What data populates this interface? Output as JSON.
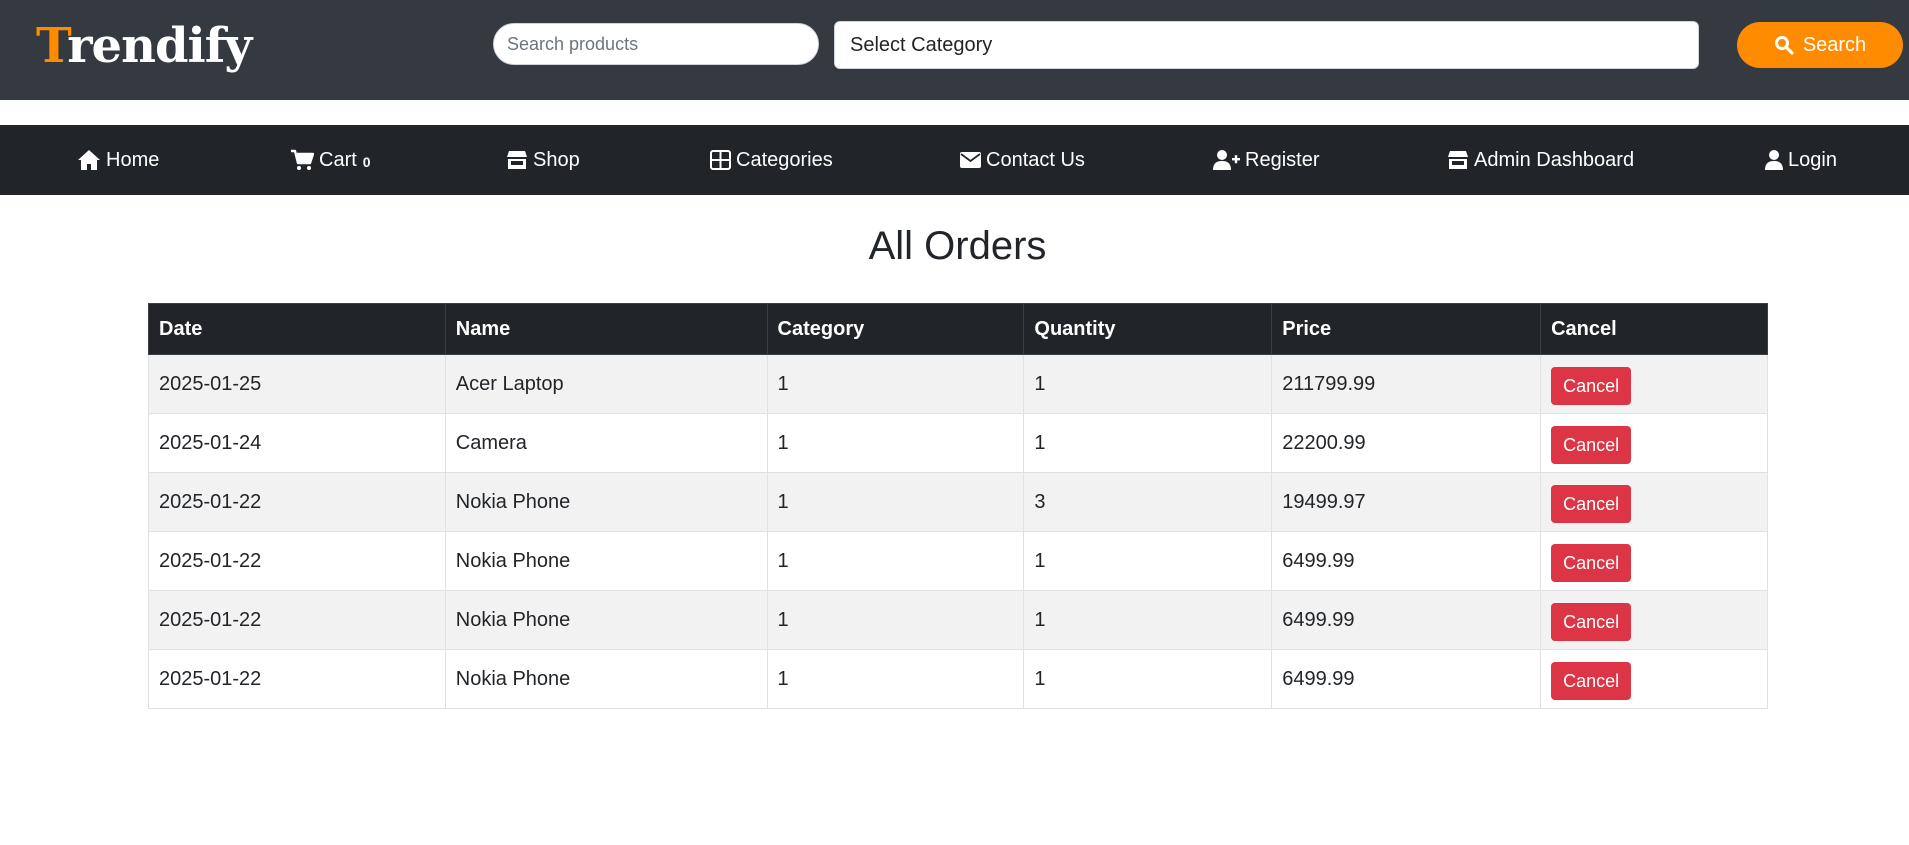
{
  "header": {
    "logo_first": "T",
    "logo_rest": "rendify",
    "search_placeholder": "Search products",
    "category_select": "Select Category",
    "search_button": "Search"
  },
  "nav": {
    "home": "Home",
    "cart": "Cart",
    "cart_count": "0",
    "shop": "Shop",
    "categories": "Categories",
    "contact": "Contact Us",
    "register": "Register",
    "admin": "Admin Dashboard",
    "login": "Login"
  },
  "page": {
    "title": "All Orders"
  },
  "orders": {
    "headers": [
      "Date",
      "Name",
      "Category",
      "Quantity",
      "Price",
      "Cancel"
    ],
    "rows": [
      {
        "date": "2025-01-25",
        "name": "Acer Laptop",
        "category": "1",
        "quantity": "1",
        "price": "211799.99",
        "action": "Cancel"
      },
      {
        "date": "2025-01-24",
        "name": "Camera",
        "category": "1",
        "quantity": "1",
        "price": "22200.99",
        "action": "Cancel"
      },
      {
        "date": "2025-01-22",
        "name": "Nokia Phone",
        "category": "1",
        "quantity": "3",
        "price": "19499.97",
        "action": "Cancel"
      },
      {
        "date": "2025-01-22",
        "name": "Nokia Phone",
        "category": "1",
        "quantity": "1",
        "price": "6499.99",
        "action": "Cancel"
      },
      {
        "date": "2025-01-22",
        "name": "Nokia Phone",
        "category": "1",
        "quantity": "1",
        "price": "6499.99",
        "action": "Cancel"
      },
      {
        "date": "2025-01-22",
        "name": "Nokia Phone",
        "category": "1",
        "quantity": "1",
        "price": "6499.99",
        "action": "Cancel"
      }
    ]
  },
  "colors": {
    "header_bg": "#343a40",
    "nav_bg": "#212529",
    "accent": "#ff8c00",
    "danger": "#dc3545"
  },
  "icons": [
    "search-icon",
    "home-icon",
    "cart-icon",
    "shop-icon",
    "categories-icon",
    "envelope-icon",
    "user-plus-icon",
    "store-icon",
    "user-icon"
  ]
}
